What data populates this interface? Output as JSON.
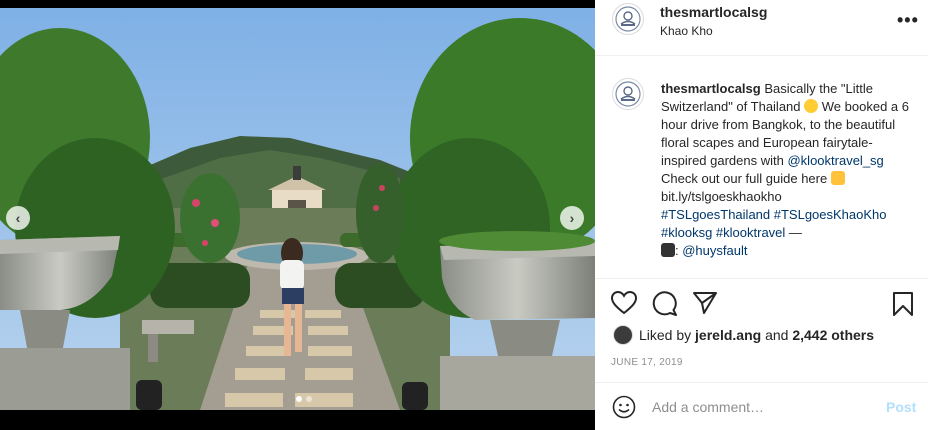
{
  "post": {
    "username": "thesmartlocalsg",
    "location": "Khao Kho"
  },
  "caption": {
    "username": "thesmartlocalsg",
    "text_1": "Basically the \"Little Switzerland\" of Thailand",
    "text_2": "We booked a 6 hour drive from Bangkok, to the beautiful floral scapes and European fairytale-inspired gardens with",
    "mention_1": "@klooktravel_sg",
    "text_3": "Check out our full guide here",
    "link_url": "bit.ly/tslgoeskhaokho",
    "hashtags": "#TSLgoesThailand #TSLgoesKhaoKho #klooksg #klooktravel",
    "dash": "—",
    "photo_credit": "@huysfault"
  },
  "likes": {
    "prefix": "Liked by",
    "user": "jereld.ang",
    "and": "and",
    "count": "2,442 others"
  },
  "date": "JUNE 17, 2019",
  "comment": {
    "placeholder": "Add a comment…",
    "post_label": "Post"
  },
  "carousel": {
    "prev": "‹",
    "next": "›",
    "slide_count": 2,
    "active_slide": 1
  },
  "colors": {
    "link": "#00376b",
    "post_disabled": "#b2dffc",
    "muted": "#8e8e8e",
    "border": "#efefef"
  },
  "icons": [
    "heart-icon",
    "comment-icon",
    "share-icon",
    "bookmark-icon",
    "emoji-icon",
    "more-icon",
    "camera-icon",
    "pointing-hand-icon",
    "smiling-heart-eyes-icon"
  ]
}
